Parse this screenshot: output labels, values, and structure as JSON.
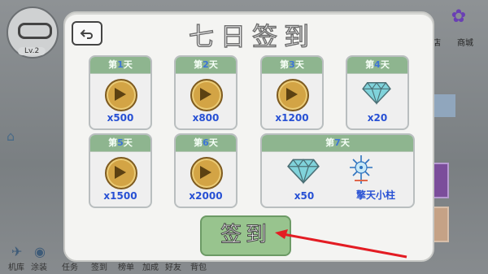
{
  "title": "七日签到",
  "background": {
    "level": "Lv.2",
    "top_right_label_1": "商店",
    "top_right_label_2": "商城",
    "bottom_labels": [
      "机库",
      "涂装",
      "任务",
      "签到",
      "榜单",
      "加成",
      "好友",
      "背包"
    ]
  },
  "cards": [
    {
      "prefix": "第",
      "day": "1",
      "suffix": "天",
      "amount": "x500"
    },
    {
      "prefix": "第",
      "day": "2",
      "suffix": "天",
      "amount": "x800"
    },
    {
      "prefix": "第",
      "day": "3",
      "suffix": "天",
      "amount": "x1200"
    },
    {
      "prefix": "第",
      "day": "4",
      "suffix": "天",
      "amount": "x20"
    },
    {
      "prefix": "第",
      "day": "5",
      "suffix": "天",
      "amount": "x1500"
    },
    {
      "prefix": "第",
      "day": "6",
      "suffix": "天",
      "amount": "x2000"
    }
  ],
  "day7": {
    "prefix": "第",
    "day": "7",
    "suffix": "天",
    "amount": "x50",
    "name": "擎天小柱"
  },
  "signin_label": "签到",
  "colors": {
    "accent_green": "#98c48e",
    "card_header": "#8eb58f",
    "amount_blue": "#2750d4",
    "arrow_red": "#e31c23"
  }
}
